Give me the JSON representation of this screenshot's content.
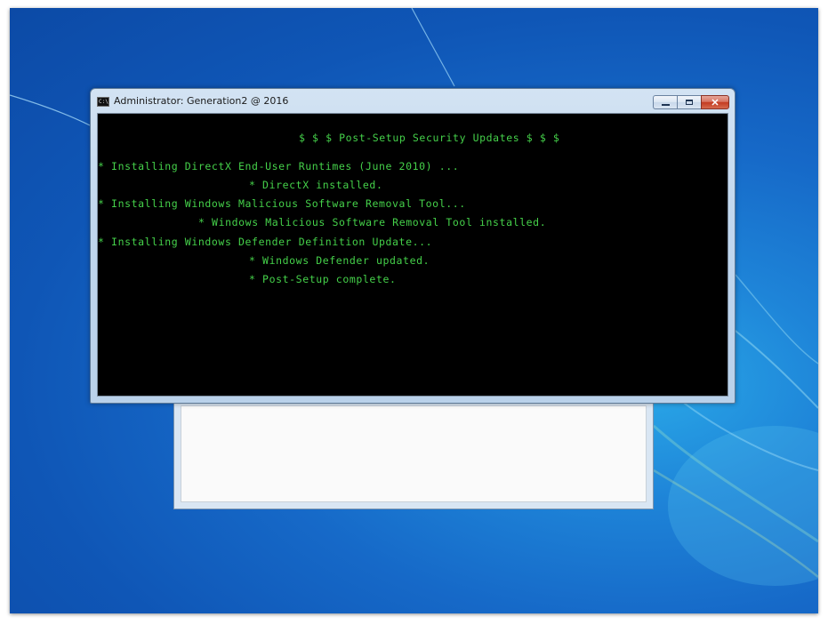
{
  "console": {
    "title": "Administrator:  Generation2 @ 2016",
    "icon": "console-icon",
    "caption_buttons": [
      "minimize",
      "maximize",
      "close"
    ],
    "close_glyph": "✕",
    "lines": [
      "$ $ $ Post-Setup Security Updates $ $ $",
      "* Installing DirectX End-User Runtimes (June 2010) ...",
      "* DirectX installed.",
      "* Installing Windows Malicious Software Removal Tool...",
      "* Windows Malicious Software Removal Tool installed.",
      "* Installing Windows Defender Definition Update...",
      "* Windows Defender updated.",
      "* Post-Setup complete."
    ],
    "text_color": "#45d14a",
    "background_color": "#000000"
  },
  "desktop": {
    "background_colors": [
      "#2aa9e8",
      "#1669c8",
      "#0c4aa6"
    ]
  }
}
